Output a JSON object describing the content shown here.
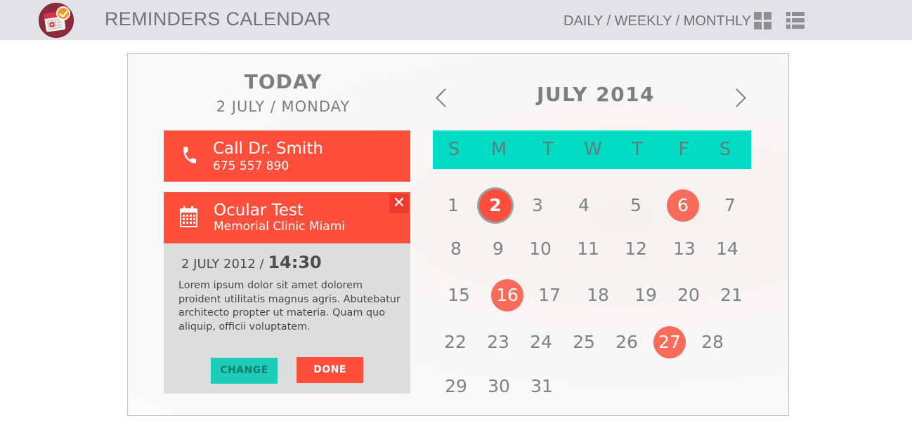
{
  "header": {
    "title": "REMINDERS CALENDAR",
    "view_links": "DAILY / WEEKLY / MONTHLY",
    "icons": [
      "app-logo-icon",
      "grid-view-icon",
      "list-view-icon"
    ]
  },
  "today": {
    "title": "TODAY",
    "date": "2 JULY / MONDAY"
  },
  "reminders": [
    {
      "title": "Call Dr. Smith",
      "subtitle": "675 557 890",
      "icon": "phone-icon"
    },
    {
      "title": "Ocular Test",
      "subtitle": "Memorial Clinic Miami",
      "icon": "calendar-icon"
    }
  ],
  "detail": {
    "close": "✕",
    "date": "2 JULY 2012 /",
    "time": "14:30",
    "description": "Lorem ipsum dolor sit amet dolorem proident utilitatis magnus agris. Abutebatur architecto propter ut materia. Quam quo aliquip, officii voluptatem.",
    "change_label": "CHANGE",
    "done_label": "DONE"
  },
  "calendar": {
    "month": "JULY 2014",
    "weekdays": [
      "S",
      "M",
      "T",
      "W",
      "T",
      "F",
      "S"
    ],
    "today_day": 2,
    "marked_days": [
      6,
      16,
      27
    ],
    "days": [
      "1",
      "2",
      "3",
      "4",
      "5",
      "6",
      "7",
      "8",
      "9",
      "10",
      "11",
      "12",
      "13",
      "14",
      "15",
      "16",
      "17",
      "18",
      "19",
      "20",
      "21",
      "22",
      "23",
      "24",
      "25",
      "26",
      "27",
      "28",
      "29",
      "30",
      "31"
    ]
  },
  "colors": {
    "accent_red": "#fd4f3b",
    "accent_teal": "#00dcc4",
    "mark_red": "#f96b5b",
    "topbar_gray": "#e2e3e6"
  }
}
